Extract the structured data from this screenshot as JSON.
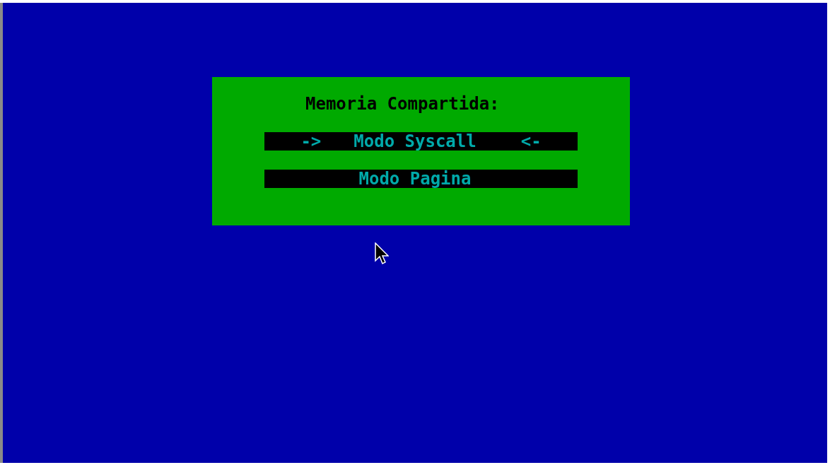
{
  "menu": {
    "title": "Memoria Compartida:",
    "marker_left": "->",
    "marker_right": "<-",
    "options": [
      {
        "label": "Modo Syscall",
        "selected": true
      },
      {
        "label": "Modo Pagina",
        "selected": false
      }
    ]
  }
}
